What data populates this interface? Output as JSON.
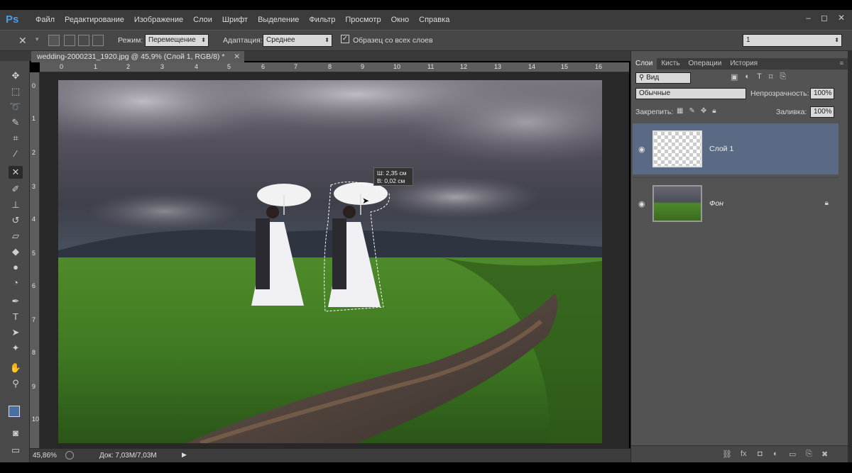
{
  "app": {
    "logo": "Ps"
  },
  "menu": [
    "Файл",
    "Редактирование",
    "Изображение",
    "Слои",
    "Шрифт",
    "Выделение",
    "Фильтр",
    "Просмотр",
    "Окно",
    "Справка"
  ],
  "window_controls": [
    "‒",
    "◻",
    "✕"
  ],
  "options": {
    "mode_label": "Режим:",
    "mode_value": "Перемещение",
    "adapt_label": "Адаптация:",
    "adapt_value": "Среднее",
    "sample_all_label": "Образец со всех слоев",
    "sample_all_checked": true,
    "right_value": "1"
  },
  "document": {
    "tab_title": "wedding-2000231_1920.jpg @ 45,9% (Слой 1, RGB/8) *",
    "ruler_top": [
      "0",
      "1",
      "2",
      "3",
      "4",
      "5",
      "6",
      "7",
      "8",
      "9",
      "10",
      "11",
      "12",
      "13",
      "14",
      "15",
      "16"
    ],
    "ruler_left": [
      "0",
      "1",
      "2",
      "3",
      "4",
      "5",
      "6",
      "7",
      "8",
      "9",
      "10",
      "1"
    ],
    "tooltip_w": "Ш: 2,35 см",
    "tooltip_h": "В: 0,02 см"
  },
  "status": {
    "zoom": "45,86%",
    "doc": "Док: 7,03M/7,03M"
  },
  "panel": {
    "tabs": [
      "Слои",
      "Кисть",
      "Операции",
      "История"
    ],
    "active_tab": "Слои",
    "filter_kind": "Вид",
    "blend_mode": "Обычные",
    "opacity_label": "Непрозрачность:",
    "opacity_value": "100%",
    "lock_label": "Закрепить:",
    "fill_label": "Заливка:",
    "fill_value": "100%",
    "layers": [
      {
        "name": "Слой 1",
        "selected": true,
        "visible": true
      },
      {
        "name": "Фон",
        "selected": false,
        "visible": true,
        "locked": true
      }
    ]
  },
  "colors": {
    "foreground": "#4a6fa5",
    "background": "#ffffff",
    "selection_accent": "#5b6a84"
  },
  "icons": {
    "tools": [
      "move-tool-icon",
      "marquee-icon",
      "lasso-icon",
      "quick-select-icon",
      "crop-icon",
      "eyedropper-icon",
      "content-aware-move-icon",
      "brush-icon",
      "stamp-icon",
      "history-brush-icon",
      "eraser-icon",
      "bucket-icon",
      "blur-icon",
      "dodge-icon",
      "pen-icon",
      "type-icon",
      "path-select-icon",
      "shape-icon",
      "hand-icon",
      "zoom-icon"
    ]
  }
}
